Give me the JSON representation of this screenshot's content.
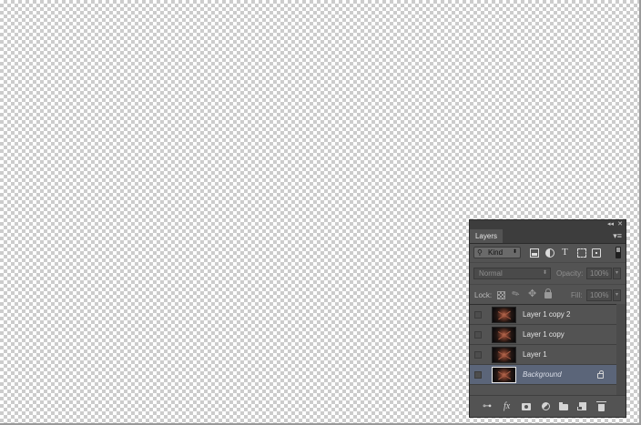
{
  "panel": {
    "collapse_icon": "◂◂",
    "close_icon": "✕",
    "tab_label": "Layers",
    "menu_icon": "▾≡"
  },
  "filter": {
    "search_icon": "⚲",
    "kind_label": "Kind",
    "arrow_icon": "⬍",
    "type_icon_glyph": "T",
    "icons": [
      "pixel-filter-icon",
      "adjustment-filter-icon",
      "type-filter-icon",
      "shape-filter-icon",
      "smart-object-filter-icon"
    ]
  },
  "blend": {
    "mode": "Normal",
    "arrow_icon": "⬍",
    "opacity_label": "Opacity:",
    "opacity_value": "100%",
    "field_arrow_icon": "▾"
  },
  "lock": {
    "label": "Lock:",
    "brush_glyph": "✎",
    "move_glyph": "✥",
    "fill_label": "Fill:",
    "fill_value": "100%"
  },
  "layers": [
    {
      "name": "Layer 1 copy 2",
      "selected": false,
      "locked": false
    },
    {
      "name": "Layer 1 copy",
      "selected": false,
      "locked": false
    },
    {
      "name": "Layer 1",
      "selected": false,
      "locked": false
    },
    {
      "name": "Background",
      "selected": true,
      "locked": true
    }
  ],
  "bottom_bar": {
    "link_glyph": "⊶",
    "fx_label": "fx",
    "icons": [
      "link-layers-icon",
      "layer-style-icon",
      "add-mask-icon",
      "new-adjustment-layer-icon",
      "new-group-icon",
      "new-layer-icon",
      "delete-layer-icon"
    ]
  },
  "colors": {
    "panel_bg": "#535353",
    "header_bg": "#3d3d3d",
    "selected_row": "#5b6579",
    "checker_dark": "#cccccc",
    "checker_light": "#ffffff"
  }
}
